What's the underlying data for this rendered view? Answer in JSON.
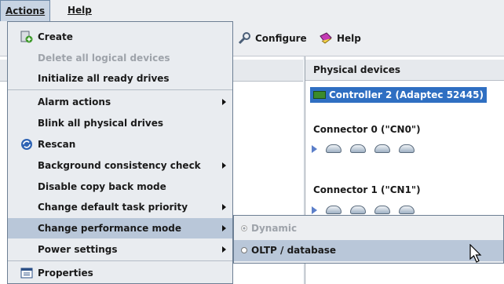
{
  "menubar": {
    "actions": "Actions",
    "help": "Help"
  },
  "toolbar": {
    "configure": "Configure",
    "help": "Help"
  },
  "physical": {
    "header": "Physical devices",
    "controller": "Controller 2 (Adaptec 52445)",
    "connector0": "Connector 0 (\"CN0\")",
    "connector1": "Connector 1 (\"CN1\")"
  },
  "actions_menu": {
    "create": "Create",
    "delete_logical": "Delete all logical devices",
    "initialize": "Initialize all ready drives",
    "alarm": "Alarm actions",
    "blink": "Blink all physical drives",
    "rescan": "Rescan",
    "consistency": "Background consistency check",
    "copyback": "Disable copy back mode",
    "priority": "Change default task priority",
    "performance": "Change performance mode",
    "power": "Power settings",
    "properties": "Properties"
  },
  "performance_submenu": {
    "dynamic": "Dynamic",
    "oltp": "OLTP / database"
  },
  "colors": {
    "highlight": "#b9c7d9",
    "selection": "#2f6fc2",
    "disabled": "#9ea3aa"
  }
}
